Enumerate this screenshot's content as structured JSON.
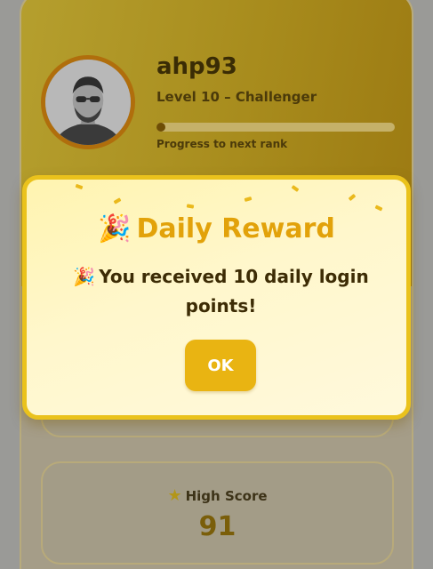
{
  "profile": {
    "username": "ahp93",
    "level": "Level 10 – Challenger",
    "progress_label": "Progress to next rank",
    "progress_fraction": 0.03
  },
  "stats": {
    "high_score_label": "High Score",
    "high_score_value": "91",
    "star_icon": "star-icon"
  },
  "modal": {
    "emoji": "🎉",
    "title": "Daily Reward",
    "message_emoji": "🎉",
    "message": "You received 10 daily login points!",
    "ok_label": "OK"
  },
  "colors": {
    "accent": "#e9b412",
    "title": "#e2a20a",
    "modal_border": "#eac21c"
  }
}
